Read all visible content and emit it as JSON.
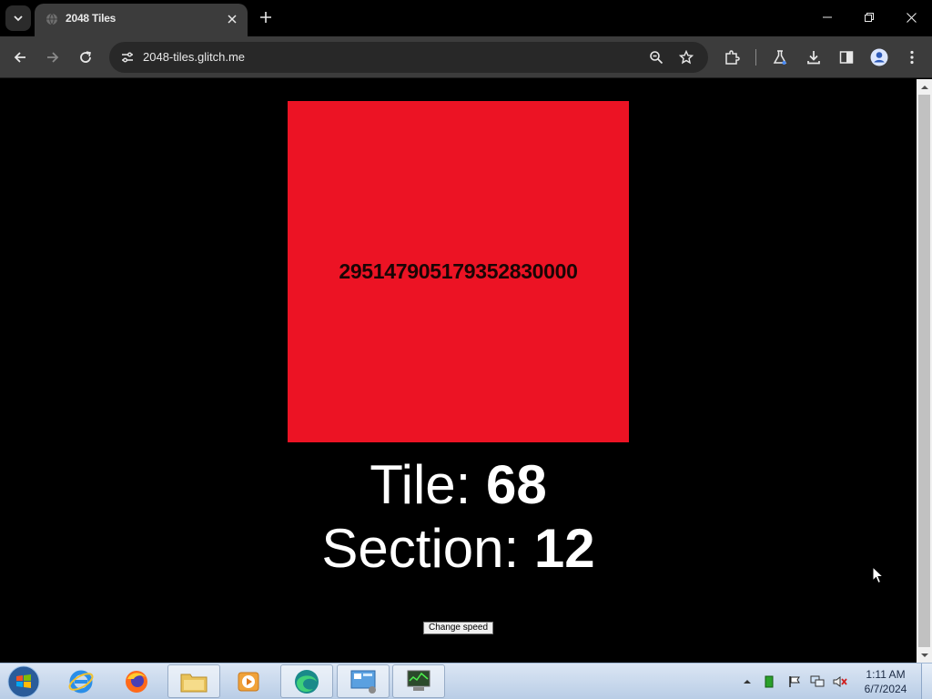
{
  "browser": {
    "tab_title": "2048 Tiles",
    "url": "2048-tiles.glitch.me",
    "icons": {
      "tab_search": "chevron-down-icon",
      "favicon": "globe-icon",
      "tab_close": "close-icon",
      "new_tab": "plus-icon",
      "back": "arrow-left-icon",
      "forward": "arrow-right-icon",
      "reload": "reload-icon",
      "site_info": "tune-icon",
      "zoom": "magnifier-icon",
      "bookmark": "star-icon",
      "extensions": "puzzle-icon",
      "labs": "flask-icon",
      "downloads": "download-icon",
      "side_panel": "side-panel-icon",
      "profile": "profile-icon",
      "menu": "kebab-menu-icon"
    }
  },
  "game": {
    "tile_color": "#ec1324",
    "tile_value": "295147905179352830000",
    "tile_label": "Tile:",
    "tile_number": "68",
    "section_label": "Section:",
    "section_number": "12",
    "speed_button": "Change speed"
  },
  "taskbar": {
    "items": [
      "start-orb",
      "internet-explorer",
      "firefox",
      "file-explorer",
      "media-player",
      "edge-app",
      "control-panel",
      "system-monitor"
    ],
    "time": "1:11 AM",
    "date": "6/7/2024"
  }
}
